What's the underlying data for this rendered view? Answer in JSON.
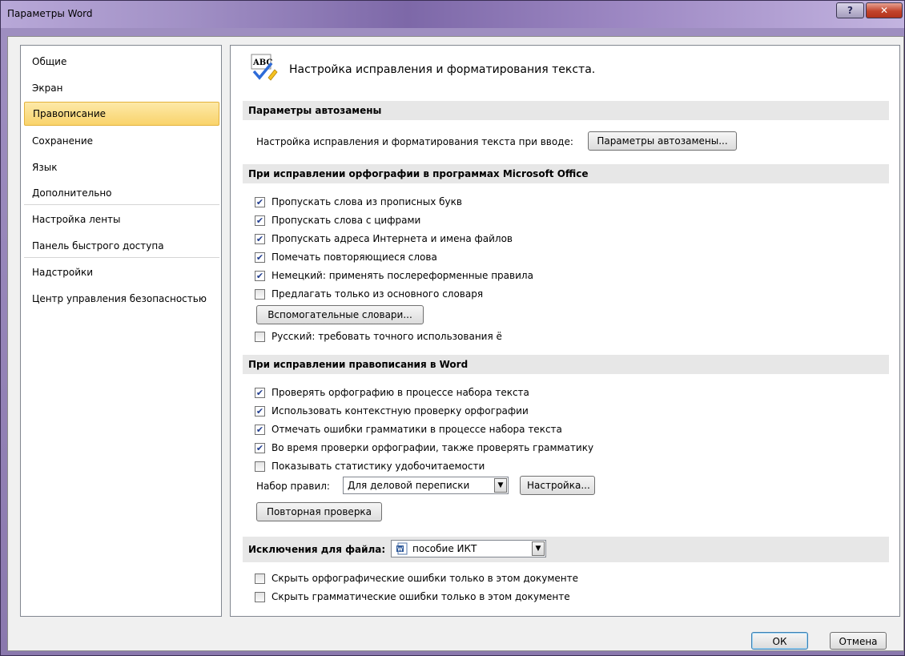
{
  "window": {
    "title": "Параметры Word",
    "help_glyph": "?",
    "close_glyph": "✕"
  },
  "nav": {
    "items": [
      {
        "label": "Общие"
      },
      {
        "label": "Экран"
      },
      {
        "label": "Правописание",
        "selected": true
      },
      {
        "label": "Сохранение"
      },
      {
        "label": "Язык"
      },
      {
        "label": "Дополнительно"
      },
      {
        "label": "Настройка ленты"
      },
      {
        "label": "Панель быстрого доступа"
      },
      {
        "label": "Надстройки"
      },
      {
        "label": "Центр управления безопасностью"
      }
    ]
  },
  "header": {
    "icon_text": "ABC",
    "title": "Настройка исправления и форматирования текста."
  },
  "autocorrect": {
    "section": "Параметры автозамены",
    "description": "Настройка исправления и форматирования текста при вводе:",
    "button": "Параметры автозамены..."
  },
  "office_spelling": {
    "section": "При исправлении орфографии в программах Microsoft Office",
    "options": [
      {
        "label": "Пропускать слова из прописных букв",
        "checked": true
      },
      {
        "label": "Пропускать слова с цифрами",
        "checked": true
      },
      {
        "label": "Пропускать адреса Интернета и имена файлов",
        "checked": true
      },
      {
        "label": "Помечать повторяющиеся слова",
        "checked": true
      },
      {
        "label": "Немецкий: применять послереформенные правила",
        "checked": true
      },
      {
        "label": "Предлагать только из основного словаря",
        "checked": false
      }
    ],
    "dictionaries_button": "Вспомогательные словари...",
    "russian_option": {
      "label": "Русский: требовать точного использования ё",
      "checked": false
    }
  },
  "word_spelling": {
    "section": "При исправлении правописания в Word",
    "options": [
      {
        "label": "Проверять орфографию в процессе набора текста",
        "checked": true
      },
      {
        "label": "Использовать контекстную проверку орфографии",
        "checked": true
      },
      {
        "label": "Отмечать ошибки грамматики в процессе набора текста",
        "checked": true
      },
      {
        "label": "Во время проверки орфографии, также проверять грамматику",
        "checked": true
      },
      {
        "label": "Показывать статистику удобочитаемости",
        "checked": false
      }
    ],
    "ruleset_label": "Набор правил:",
    "ruleset_value": "Для деловой переписки",
    "settings_button": "Настройка...",
    "recheck_button": "Повторная проверка"
  },
  "exceptions": {
    "label": "Исключения для файла:",
    "file_value": "пособие ИКТ",
    "options": [
      {
        "label": "Скрыть орфографические ошибки только в этом документе",
        "checked": false
      },
      {
        "label": "Скрыть грамматические ошибки только в этом документе",
        "checked": false
      }
    ]
  },
  "footer": {
    "ok": "ОК",
    "cancel": "Отмена"
  },
  "colors": {
    "accent_selected": "#f9d36b",
    "section_bg": "#e7e7e7",
    "check": "#213d8f"
  },
  "checkmark": "✔",
  "dropdown_arrow": "▼"
}
